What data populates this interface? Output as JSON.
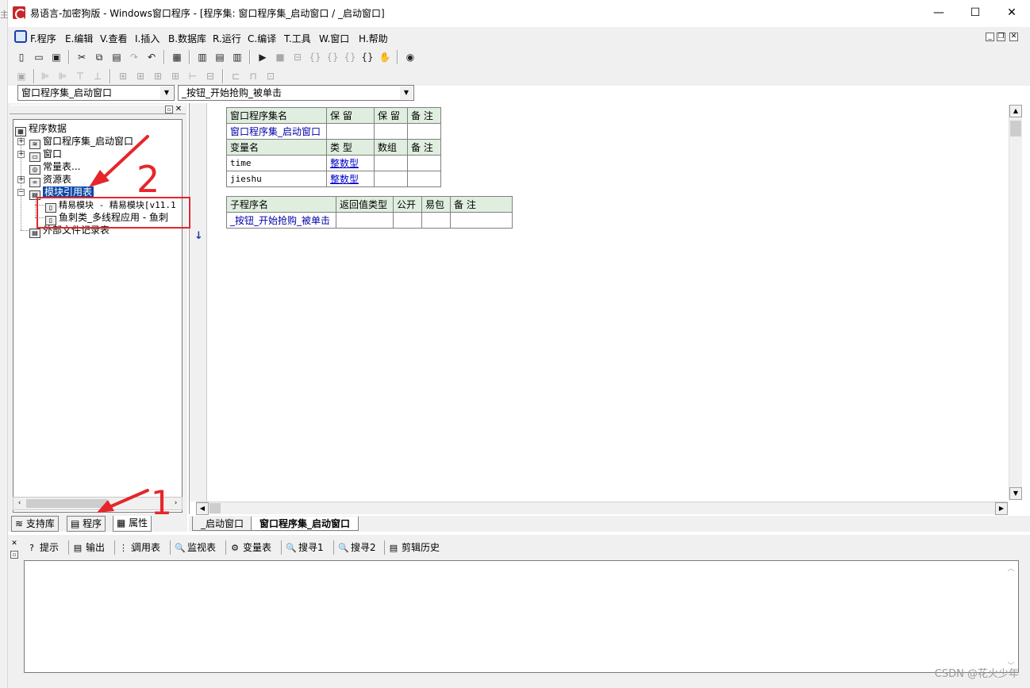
{
  "edge_text": "主",
  "window": {
    "title": "易语言-加密狗版 - Windows窗口程序 - [程序集: 窗口程序集_启动窗口 / _启动窗口]",
    "minimize": "—",
    "maximize": "☐",
    "close": "✕"
  },
  "menu": {
    "items": [
      "F.程序",
      "E.编辑",
      "V.查看",
      "I.插入",
      "B.数据库",
      "R.运行",
      "C.编译",
      "T.工具",
      "W.窗口",
      "H.帮助"
    ],
    "mdi_min": "_",
    "mdi_restore": "❐",
    "mdi_close": "✕"
  },
  "selectors": {
    "class_combo": "窗口程序集_启动窗口",
    "method_combo": "_按钮_开始抢购_被单击"
  },
  "tree": {
    "root": "程序数据",
    "nodes": [
      "窗口程序集_启动窗口",
      "窗口",
      "常量表...",
      "资源表",
      "模块引用表"
    ],
    "modules": [
      "精易模块 - 精易模块[v11.1",
      "鱼刺类_多线程应用 - 鱼刺"
    ],
    "external": "外部文件记录表",
    "expand_plus": "+",
    "expand_minus": "−"
  },
  "left_tabs": [
    "支持库",
    "程序",
    "属性"
  ],
  "left_tab_icons": [
    "lib-icon",
    "program-icon",
    "property-icon"
  ],
  "code": {
    "class_header": [
      "窗口程序集名",
      "保 留",
      "保 留",
      "备 注"
    ],
    "class_row": [
      "窗口程序集_启动窗口",
      "",
      "",
      ""
    ],
    "var_header": [
      "变量名",
      "类 型",
      "数组",
      "备 注"
    ],
    "vars": [
      [
        "time",
        "整数型",
        "",
        ""
      ],
      [
        "jieshu",
        "整数型",
        "",
        ""
      ]
    ],
    "sub_header": [
      "子程序名",
      "返回值类型",
      "公开",
      "易包",
      "备 注"
    ],
    "sub_row": [
      "_按钮_开始抢购_被单击",
      "",
      "",
      "",
      ""
    ]
  },
  "gutter_marker": "↓",
  "editor_tabs": [
    "_启动窗口",
    "窗口程序集_启动窗口"
  ],
  "output_tabs": [
    "提示",
    "输出",
    "调用表",
    "监视表",
    "变量表",
    "搜寻1",
    "搜寻2",
    "剪辑历史"
  ],
  "output_tab_icons": [
    "?",
    "▤",
    "⋮⋮",
    "🔍",
    "⚙",
    "🔍",
    "🔍",
    "▤"
  ],
  "annotation": {
    "digit_1": "1",
    "digit_2": "2",
    "color": "#e5262b"
  },
  "watermark": "CSDN @花火少年"
}
